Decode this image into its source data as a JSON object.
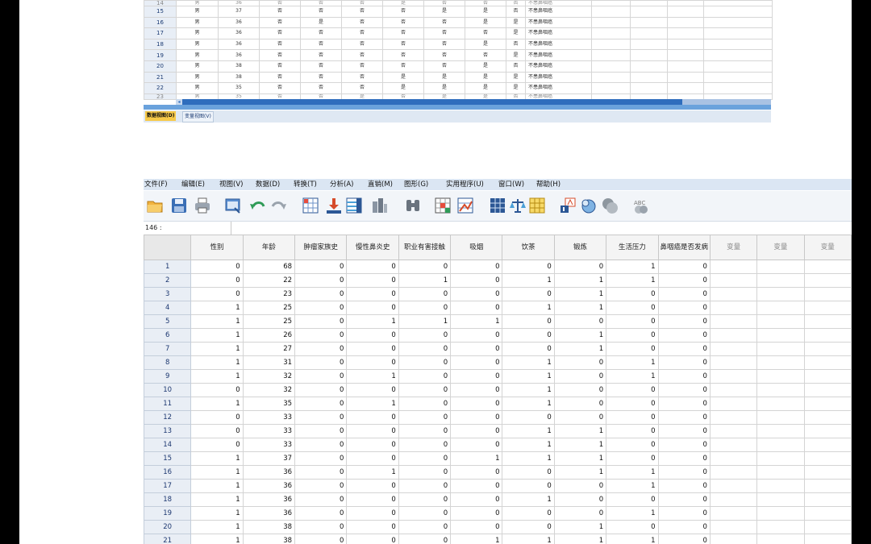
{
  "top_view": {
    "columns": 14,
    "rows": [
      {
        "n": "14",
        "cells": [
          "男",
          "36",
          "否",
          "否",
          "否",
          "是",
          "否",
          "否",
          "否",
          "不患鼻咽癌",
          "",
          "",
          "",
          ""
        ],
        "partial": true
      },
      {
        "n": "15",
        "cells": [
          "男",
          "37",
          "否",
          "否",
          "否",
          "否",
          "是",
          "是",
          "否",
          "不患鼻咽癌",
          "",
          "",
          "",
          ""
        ]
      },
      {
        "n": "16",
        "cells": [
          "男",
          "36",
          "否",
          "是",
          "否",
          "否",
          "否",
          "是",
          "是",
          "不患鼻咽癌",
          "",
          "",
          "",
          ""
        ]
      },
      {
        "n": "17",
        "cells": [
          "男",
          "36",
          "否",
          "否",
          "否",
          "否",
          "否",
          "否",
          "是",
          "不患鼻咽癌",
          "",
          "",
          "",
          ""
        ]
      },
      {
        "n": "18",
        "cells": [
          "男",
          "36",
          "否",
          "否",
          "否",
          "否",
          "否",
          "是",
          "否",
          "不患鼻咽癌",
          "",
          "",
          "",
          ""
        ]
      },
      {
        "n": "19",
        "cells": [
          "男",
          "36",
          "否",
          "否",
          "否",
          "否",
          "否",
          "否",
          "是",
          "不患鼻咽癌",
          "",
          "",
          "",
          ""
        ]
      },
      {
        "n": "20",
        "cells": [
          "男",
          "38",
          "否",
          "否",
          "否",
          "否",
          "否",
          "是",
          "否",
          "不患鼻咽癌",
          "",
          "",
          "",
          ""
        ]
      },
      {
        "n": "21",
        "cells": [
          "男",
          "38",
          "否",
          "否",
          "否",
          "是",
          "是",
          "是",
          "是",
          "不患鼻咽癌",
          "",
          "",
          "",
          ""
        ]
      },
      {
        "n": "22",
        "cells": [
          "男",
          "35",
          "否",
          "否",
          "否",
          "是",
          "是",
          "是",
          "是",
          "不患鼻咽癌",
          "",
          "",
          "",
          ""
        ]
      },
      {
        "n": "23",
        "cells": [
          "男",
          "35",
          "否",
          "否",
          "是",
          "否",
          "是",
          "是",
          "否",
          "不患鼻咽癌",
          "",
          "",
          "",
          ""
        ],
        "partial": true
      }
    ],
    "tabs": {
      "data_view": "数据视图(D)",
      "variable_view": "变量视图(V)"
    }
  },
  "menu": [
    "文件(F)",
    "编辑(E)",
    "视图(V)",
    "数据(D)",
    "转换(T)",
    "分析(A)",
    "直销(M)",
    "图形(G)",
    "实用程序(U)",
    "窗口(W)",
    "帮助(H)"
  ],
  "toolbar_icons": [
    "open-folder-icon",
    "save-icon",
    "print-icon",
    "dialog-recall-icon",
    "undo-icon",
    "redo-icon",
    "goto-case-icon",
    "goto-variable-icon",
    "variables-icon",
    "run-descriptives-icon",
    "find-icon",
    "insert-cases-icon",
    "insert-variable-icon",
    "split-file-icon",
    "weight-cases-icon",
    "select-cases-icon",
    "value-labels-icon",
    "use-variable-sets-icon",
    "show-all-variables-icon",
    "spell-check-icon"
  ],
  "cell_reference": "146 :",
  "grid": {
    "headers": [
      "性别",
      "年龄",
      "肿瘤家族史",
      "慢性鼻炎史",
      "职业有害接触",
      "吸烟",
      "饮茶",
      "锻炼",
      "生活压力",
      "鼻咽癌是否发病",
      "变量",
      "变量",
      "变量"
    ],
    "rows": [
      {
        "n": "1",
        "v": [
          "0",
          "68",
          "0",
          "0",
          "0",
          "0",
          "0",
          "0",
          "1",
          "0"
        ]
      },
      {
        "n": "2",
        "v": [
          "0",
          "22",
          "0",
          "0",
          "1",
          "0",
          "1",
          "1",
          "1",
          "0"
        ]
      },
      {
        "n": "3",
        "v": [
          "0",
          "23",
          "0",
          "0",
          "0",
          "0",
          "0",
          "1",
          "0",
          "0"
        ]
      },
      {
        "n": "4",
        "v": [
          "1",
          "25",
          "0",
          "0",
          "0",
          "0",
          "1",
          "1",
          "0",
          "0"
        ]
      },
      {
        "n": "5",
        "v": [
          "1",
          "25",
          "0",
          "1",
          "1",
          "1",
          "0",
          "0",
          "0",
          "0"
        ]
      },
      {
        "n": "6",
        "v": [
          "1",
          "26",
          "0",
          "0",
          "0",
          "0",
          "0",
          "1",
          "0",
          "0"
        ]
      },
      {
        "n": "7",
        "v": [
          "1",
          "27",
          "0",
          "0",
          "0",
          "0",
          "0",
          "1",
          "0",
          "0"
        ]
      },
      {
        "n": "8",
        "v": [
          "1",
          "31",
          "0",
          "0",
          "0",
          "0",
          "1",
          "0",
          "1",
          "0"
        ]
      },
      {
        "n": "9",
        "v": [
          "1",
          "32",
          "0",
          "1",
          "0",
          "0",
          "1",
          "0",
          "1",
          "0"
        ]
      },
      {
        "n": "10",
        "v": [
          "0",
          "32",
          "0",
          "0",
          "0",
          "0",
          "1",
          "0",
          "0",
          "0"
        ]
      },
      {
        "n": "11",
        "v": [
          "1",
          "35",
          "0",
          "1",
          "0",
          "0",
          "1",
          "0",
          "0",
          "0"
        ]
      },
      {
        "n": "12",
        "v": [
          "0",
          "33",
          "0",
          "0",
          "0",
          "0",
          "0",
          "0",
          "0",
          "0"
        ]
      },
      {
        "n": "13",
        "v": [
          "0",
          "33",
          "0",
          "0",
          "0",
          "0",
          "1",
          "1",
          "0",
          "0"
        ]
      },
      {
        "n": "14",
        "v": [
          "0",
          "33",
          "0",
          "0",
          "0",
          "0",
          "1",
          "1",
          "0",
          "0"
        ]
      },
      {
        "n": "15",
        "v": [
          "1",
          "37",
          "0",
          "0",
          "0",
          "1",
          "1",
          "1",
          "0",
          "0"
        ]
      },
      {
        "n": "16",
        "v": [
          "1",
          "36",
          "0",
          "1",
          "0",
          "0",
          "0",
          "1",
          "1",
          "0"
        ]
      },
      {
        "n": "17",
        "v": [
          "1",
          "36",
          "0",
          "0",
          "0",
          "0",
          "0",
          "0",
          "1",
          "0"
        ]
      },
      {
        "n": "18",
        "v": [
          "1",
          "36",
          "0",
          "0",
          "0",
          "0",
          "1",
          "0",
          "0",
          "0"
        ]
      },
      {
        "n": "19",
        "v": [
          "1",
          "36",
          "0",
          "0",
          "0",
          "0",
          "0",
          "0",
          "1",
          "0"
        ]
      },
      {
        "n": "20",
        "v": [
          "1",
          "38",
          "0",
          "0",
          "0",
          "0",
          "0",
          "1",
          "0",
          "0"
        ]
      },
      {
        "n": "21",
        "v": [
          "1",
          "38",
          "0",
          "0",
          "0",
          "1",
          "1",
          "1",
          "1",
          "0"
        ]
      }
    ]
  },
  "colors": {
    "accent_blue": "#2e6dbd",
    "active_tab": "#f7c948",
    "row_header": "#e9eef5"
  }
}
